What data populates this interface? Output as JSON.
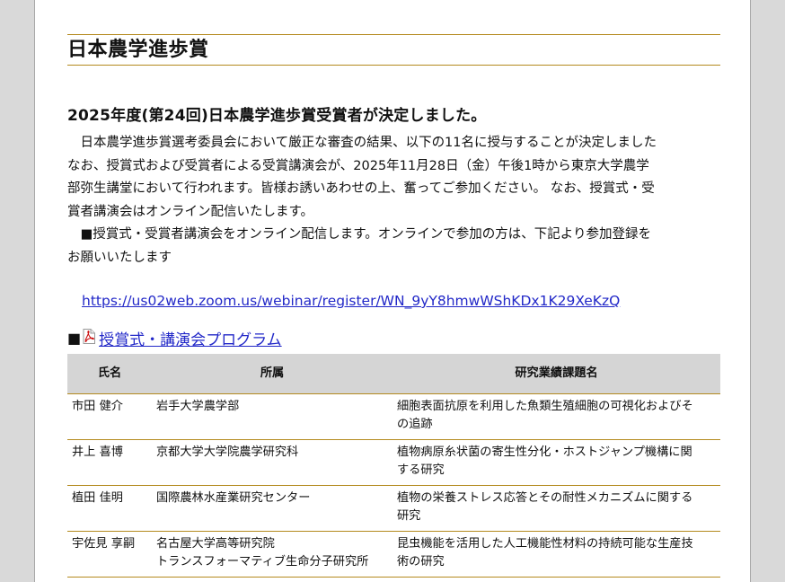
{
  "page_title": "日本農学進歩賞",
  "announcement": {
    "heading": "2025年度(第24回)日本農学進歩賞受賞者が決定しました。",
    "line1": "日本農学進歩賞選考委員会において厳正な審査の結果、以下の11名に授与することが決定しました",
    "line2": "なお、授賞式および受賞者による受賞講演会が、2025年11月28日（金）午後1時から東京大学農学",
    "line3": "部弥生講堂において行われます。皆様お誘いあわせの上、奮ってご参加ください。 なお、授賞式・受",
    "line4": "賞者講演会はオンライン配信いたします。",
    "online_line1": "■授賞式・受賞者講演会をオンライン配信します。オンラインで参加の方は、下記より参加登録を",
    "online_line2": "お願いいたします",
    "zoom_url": "https://us02web.zoom.us/webinar/register/WN_9yY8hmwWShKDx1K29XeKzQ"
  },
  "program": {
    "bullet": "■",
    "link_label": "授賞式・講演会プログラム",
    "icon": "pdf-icon"
  },
  "table": {
    "headers": {
      "name": "氏名",
      "affiliation": "所属",
      "title": "研究業績課題名"
    },
    "rows": [
      {
        "name": "市田 健介",
        "affiliation": [
          "岩手大学農学部"
        ],
        "title": [
          "細胞表面抗原を利用した魚類生殖細胞の可視化およびそ",
          "の追跡"
        ]
      },
      {
        "name": "井上 喜博",
        "affiliation": [
          "京都大学大学院農学研究科"
        ],
        "title": [
          "植物病原糸状菌の寄生性分化・ホストジャンプ機構に関",
          "する研究"
        ]
      },
      {
        "name": "植田 佳明",
        "affiliation": [
          "国際農林水産業研究センター"
        ],
        "title": [
          "植物の栄養ストレス応答とその耐性メカニズムに関する",
          "研究"
        ]
      },
      {
        "name": "宇佐見 享嗣",
        "affiliation": [
          "名古屋大学高等研究院",
          "トランスフォーマティブ生命分子研究所"
        ],
        "title": [
          "昆虫機能を活用した人工機能性材料の持続可能な生産技",
          "術の研究"
        ]
      }
    ]
  }
}
